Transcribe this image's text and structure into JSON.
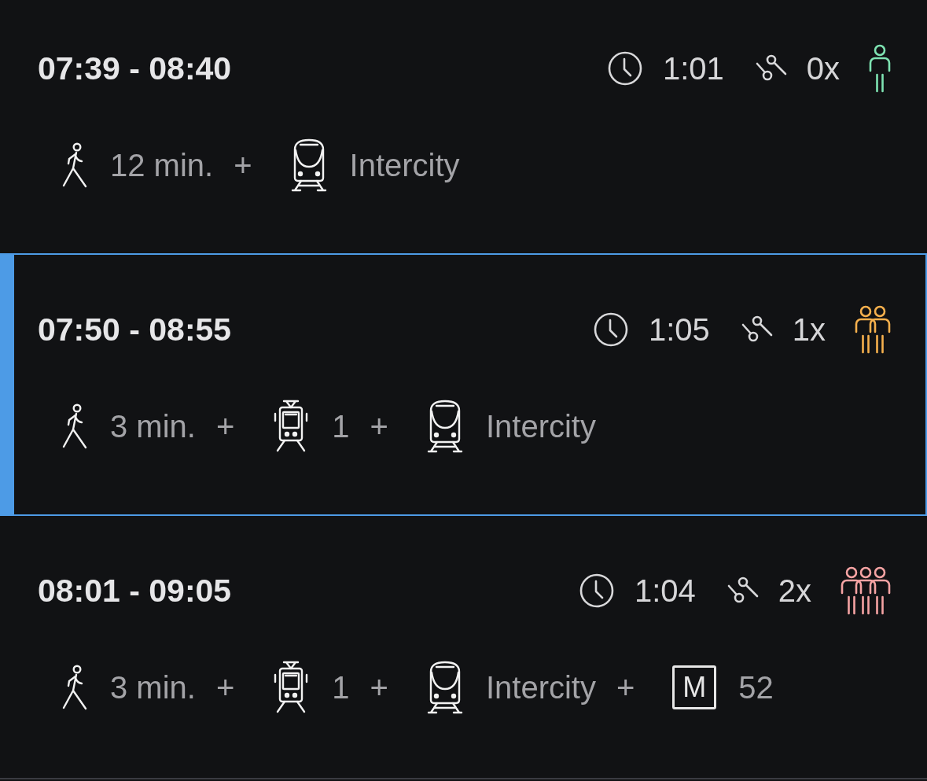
{
  "trips": [
    {
      "selected": false,
      "time_range": "07:39 - 08:40",
      "duration": "1:01",
      "transfers": "0x",
      "crowding": {
        "kind": "low",
        "color": "#7ee3b2"
      },
      "legs": [
        {
          "kind": "walk",
          "text": "12 min."
        },
        {
          "kind": "plus",
          "text": "+"
        },
        {
          "kind": "train",
          "text": "Intercity"
        }
      ]
    },
    {
      "selected": true,
      "time_range": "07:50 - 08:55",
      "duration": "1:05",
      "transfers": "1x",
      "crowding": {
        "kind": "medium",
        "color": "#f5b04d"
      },
      "legs": [
        {
          "kind": "walk",
          "text": "3 min."
        },
        {
          "kind": "plus",
          "text": "+"
        },
        {
          "kind": "tram",
          "text": "1"
        },
        {
          "kind": "plus",
          "text": "+"
        },
        {
          "kind": "train",
          "text": "Intercity"
        }
      ]
    },
    {
      "selected": false,
      "time_range": "08:01 - 09:05",
      "duration": "1:04",
      "transfers": "2x",
      "crowding": {
        "kind": "high",
        "color": "#f5a3a3"
      },
      "legs": [
        {
          "kind": "walk",
          "text": "3 min."
        },
        {
          "kind": "plus",
          "text": "+"
        },
        {
          "kind": "tram",
          "text": "1"
        },
        {
          "kind": "plus",
          "text": "+"
        },
        {
          "kind": "train",
          "text": "Intercity"
        },
        {
          "kind": "plus",
          "text": "+"
        },
        {
          "kind": "metro",
          "badge": "M",
          "text": "52"
        }
      ]
    }
  ]
}
